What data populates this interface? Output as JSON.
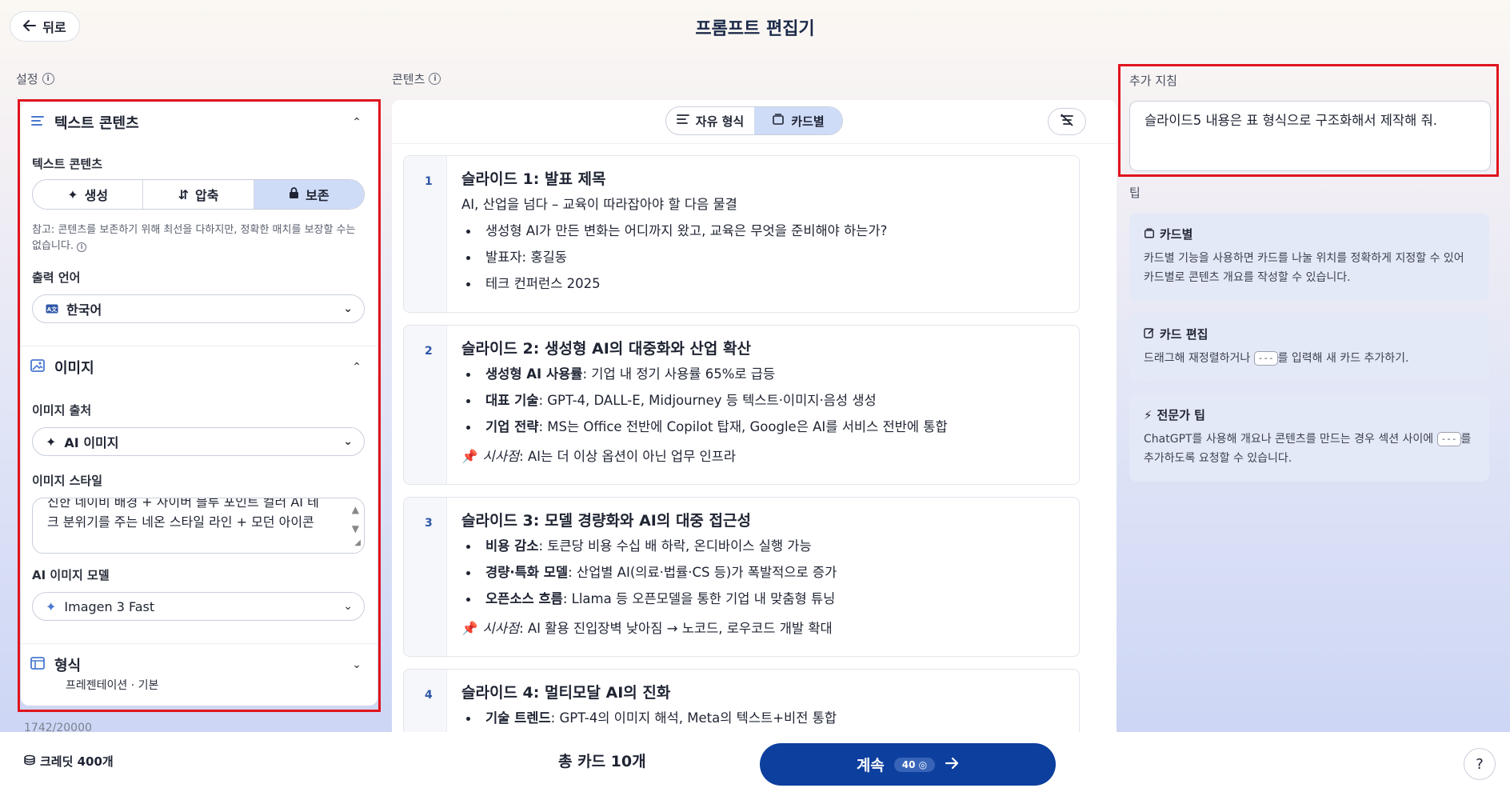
{
  "header": {
    "back_label": "뒤로",
    "title": "프롬프트 편집기"
  },
  "settings": {
    "label": "설정",
    "text_content": {
      "title": "텍스트 콘텐츠",
      "field_label": "텍스트 콘텐츠",
      "options": [
        "생성",
        "압축",
        "보존"
      ],
      "selected": "보존",
      "note": "참고: 콘텐츠를 보존하기 위해 최선을 다하지만, 정확한 매치를 보장할 수는 없습니다.",
      "output_language_label": "출력 언어",
      "output_language_value": "한국어"
    },
    "image": {
      "title": "이미지",
      "source_label": "이미지 출처",
      "source_value": "AI 이미지",
      "style_label": "이미지 스타일",
      "style_value": "진한 네이비 배경 + 사이버 블루 포인트 컬러 AI 테크 분위기를 주는 네온 스타일 라인 + 모던 아이콘",
      "model_label": "AI 이미지 모델",
      "model_value": "Imagen 3 Fast"
    },
    "format": {
      "title": "형식",
      "subtitle": "프레젠테이션 · 기본"
    },
    "counter": "1742/20000"
  },
  "content": {
    "label": "콘텐츠",
    "toggle": [
      "자유 형식",
      "카드별"
    ],
    "toggle_selected": "카드별",
    "cards": [
      {
        "num": "1",
        "title": "슬라이드 1: 발표 제목",
        "subtitle": "AI, 산업을 넘다 – 교육이 따라잡아야 할 다음 물결",
        "bullets": [
          {
            "bold": "",
            "text": "생성형 AI가 만든 변화는 어디까지 왔고, 교육은 무엇을 준비해야 하는가?"
          },
          {
            "bold": "",
            "text": "발표자: 홍길동"
          },
          {
            "bold": "",
            "text": "테크 컨퍼런스 2025"
          }
        ]
      },
      {
        "num": "2",
        "title": "슬라이드 2: 생성형 AI의 대중화와 산업 확산",
        "bullets": [
          {
            "bold": "생성형 AI 사용률",
            "text": ": 기업 내 정기 사용률 65%로 급등"
          },
          {
            "bold": "대표 기술",
            "text": ": GPT-4, DALL-E, Midjourney 등 텍스트·이미지·음성 생성"
          },
          {
            "bold": "기업 전략",
            "text": ": MS는 Office 전반에 Copilot 탑재, Google은 AI를 서비스 전반에 통합"
          }
        ],
        "insight_label": "시사점",
        "insight": ": AI는 더 이상 옵션이 아닌 업무 인프라"
      },
      {
        "num": "3",
        "title": "슬라이드 3: 모델 경량화와 AI의 대중 접근성",
        "bullets": [
          {
            "bold": "비용 감소",
            "text": ": 토큰당 비용 수십 배 하락, 온디바이스 실행 가능"
          },
          {
            "bold": "경량·특화 모델",
            "text": ": 산업별 AI(의료·법률·CS 등)가 폭발적으로 증가"
          },
          {
            "bold": "오픈소스 흐름",
            "text": ": Llama 등 오픈모델을 통한 기업 내 맞춤형 튜닝"
          }
        ],
        "insight_label": "시사점",
        "insight": ": AI 활용 진입장벽 낮아짐 → 노코드, 로우코드 개발 확대"
      },
      {
        "num": "4",
        "title": "슬라이드 4: 멀티모달 AI의 진화",
        "bullets": [
          {
            "bold": "기술 트렌드",
            "text": ": GPT-4의 이미지 해석, Meta의 텍스트+비전 통합"
          }
        ]
      }
    ]
  },
  "extra": {
    "label": "추가 지침",
    "value": "슬라이드5 내용은 표 형식으로 구조화해서 제작해 줘."
  },
  "tips": {
    "label": "팁",
    "items": [
      {
        "title": "카드별",
        "text": "카드별 기능을 사용하면 카드를 나눌 위치를 정확하게 지정할 수 있어 카드별로 콘텐츠 개요를 작성할 수 있습니다."
      },
      {
        "title": "카드 편집",
        "text_before": "드래그해 재정렬하거나",
        "kbd": "---",
        "text_after": "를 입력해 새 카드 추가하기."
      },
      {
        "title": "전문가 팁",
        "text_before": "ChatGPT를 사용해 개요나 콘텐츠를 만드는 경우 섹션 사이에",
        "kbd": "---",
        "text_after": "를 추가하도록 요청할 수 있습니다."
      }
    ]
  },
  "footer": {
    "credits": "크레딧 400개",
    "total_cards": "총 카드 10개",
    "continue_label": "계속",
    "cost": "40",
    "help": "?"
  },
  "colors": {
    "accent": "#0c3f9e",
    "highlight_outline": "#e0141d",
    "selected_seg": "#cfdcf8"
  }
}
